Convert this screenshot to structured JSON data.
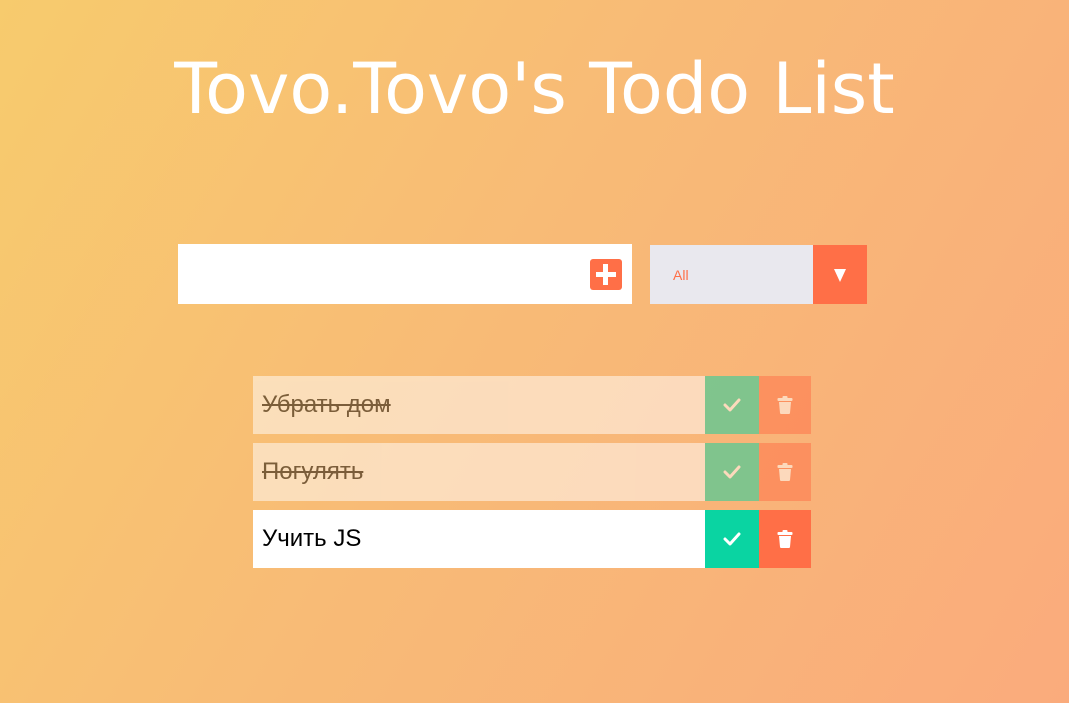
{
  "header": {
    "title": "Tovo.Tovo's Todo List"
  },
  "form": {
    "input_value": "",
    "add_icon": "plus-icon",
    "filter_selected": "All",
    "filter_arrow_icon": "triangle-down-icon"
  },
  "todos": [
    {
      "text": "Убрать дом",
      "completed": true
    },
    {
      "text": "Погулять",
      "completed": true
    },
    {
      "text": "Учить JS",
      "completed": false
    }
  ],
  "colors": {
    "accent": "#ff6f47",
    "check": "#0ad4a2",
    "select_bg": "#e9e8ee",
    "background_start": "#f7cb6d",
    "background_end": "#faab7c"
  }
}
